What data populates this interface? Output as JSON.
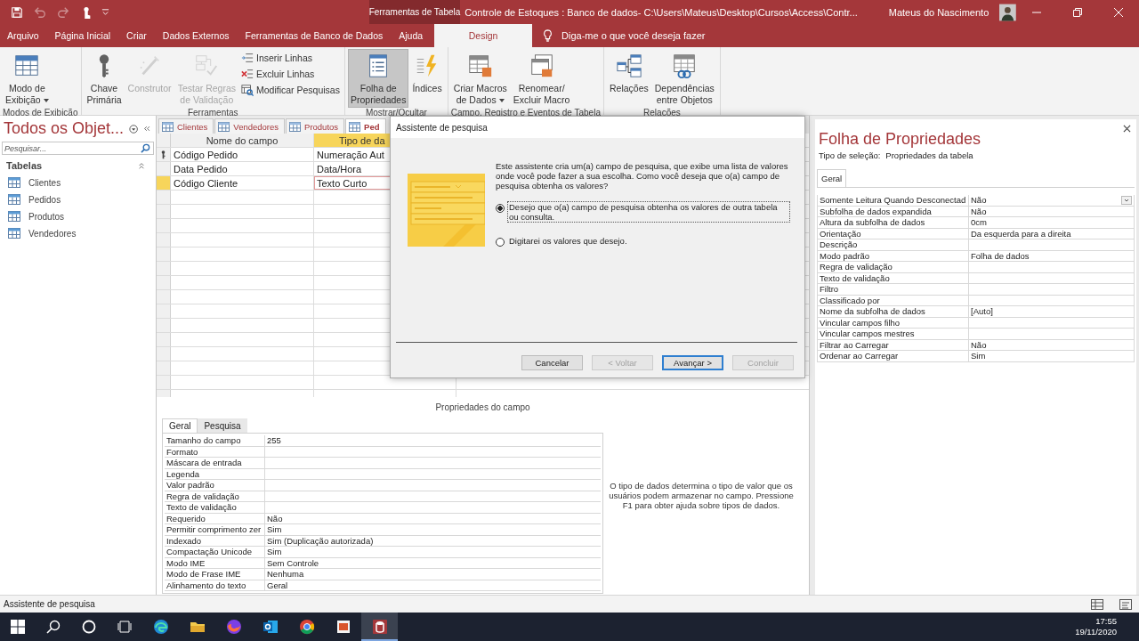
{
  "title_bar": {
    "quick_access": [
      {
        "disabled": false
      },
      {
        "disabled": true
      },
      {
        "disabled": true
      },
      {
        "disabled": false
      }
    ],
    "context_tab": "Ferramentas de Tabela",
    "title": "Controle de Estoques : Banco de dados- C:\\Users\\Mateus\\Desktop\\Cursos\\Access\\Contr...",
    "user": "Mateus do Nascimento"
  },
  "ribbon_tabs": [
    {
      "label": "Arquivo",
      "selected": false
    },
    {
      "label": "Página Inicial",
      "selected": false
    },
    {
      "label": "Criar",
      "selected": false
    },
    {
      "label": "Dados Externos",
      "selected": false
    },
    {
      "label": "Ferramentas de Banco de Dados",
      "selected": false
    },
    {
      "label": "Ajuda",
      "selected": false
    },
    {
      "label": "Design",
      "selected": true
    }
  ],
  "tell_me": "Diga-me o que você deseja fazer",
  "ribbon_groups": [
    {
      "label": "Modos de Exibição",
      "buttons": [
        {
          "label": "Modo de\nExibição",
          "kind": "large",
          "menu": true,
          "disabled": false,
          "selected": false
        }
      ]
    },
    {
      "label": "Ferramentas",
      "buttons": [
        {
          "label": "Chave\nPrimária",
          "kind": "large",
          "menu": false,
          "disabled": false,
          "selected": false
        },
        {
          "label": "Construtor",
          "kind": "large",
          "menu": false,
          "disabled": true,
          "selected": false
        },
        {
          "label": "Testar Regras\nde Validação",
          "kind": "large",
          "menu": false,
          "disabled": true,
          "selected": false
        },
        {
          "label": "Inserir Linhas",
          "kind": "small",
          "disabled": false
        },
        {
          "label": "Excluir Linhas",
          "kind": "small",
          "disabled": false
        },
        {
          "label": "Modificar Pesquisas",
          "kind": "small",
          "disabled": false
        }
      ]
    },
    {
      "label": "Mostrar/Ocultar",
      "buttons": [
        {
          "label": "Folha de\nPropriedades",
          "kind": "large",
          "menu": false,
          "disabled": false,
          "selected": true
        },
        {
          "label": "Índices",
          "kind": "large",
          "menu": false,
          "disabled": false,
          "selected": false
        }
      ]
    },
    {
      "label": "Campo, Registro e Eventos de Tabela",
      "buttons": [
        {
          "label": "Criar Macros\nde Dados",
          "kind": "large",
          "menu": true,
          "disabled": false,
          "selected": false
        },
        {
          "label": "Renomear/\nExcluir Macro",
          "kind": "large",
          "menu": false,
          "disabled": false,
          "selected": false
        }
      ]
    },
    {
      "label": "Relações",
      "buttons": [
        {
          "label": "Relações",
          "kind": "large",
          "menu": false,
          "disabled": false,
          "selected": false
        },
        {
          "label": "Dependências\nentre Objetos",
          "kind": "large",
          "menu": false,
          "disabled": false,
          "selected": false
        }
      ]
    }
  ],
  "navigation": {
    "title": "Todos os Objet...",
    "search_placeholder": "Pesquisar...",
    "groups": [
      {
        "label": "Tabelas",
        "expanded": true,
        "items": [
          "Clientes",
          "Pedidos",
          "Produtos",
          "Vendedores"
        ]
      }
    ]
  },
  "document_tabs": [
    {
      "label": "Clientes",
      "selected": false
    },
    {
      "label": "Vendedores",
      "selected": false
    },
    {
      "label": "Produtos",
      "selected": false
    },
    {
      "label": "Ped",
      "selected": true
    }
  ],
  "design_grid": {
    "columns": [
      {
        "label": "Nome do campo",
        "selected": false
      },
      {
        "label": "Tipo de da",
        "selected": true
      }
    ],
    "rows": [
      {
        "name": "Código Pedido",
        "type": "Numeração Aut",
        "primary_key": true,
        "selected": false
      },
      {
        "name": "Data Pedido",
        "type": "Data/Hora",
        "primary_key": false,
        "selected": false
      },
      {
        "name": "Código Cliente",
        "type": "Texto Curto",
        "primary_key": false,
        "selected": true
      }
    ]
  },
  "field_properties": {
    "heading": "Propriedades do campo",
    "tabs": [
      {
        "label": "Geral",
        "selected": true
      },
      {
        "label": "Pesquisa",
        "selected": false
      }
    ],
    "rows": [
      {
        "label": "Tamanho do campo",
        "value": "255"
      },
      {
        "label": "Formato"
      },
      {
        "label": "Máscara de entrada"
      },
      {
        "label": "Legenda"
      },
      {
        "label": "Valor padrão"
      },
      {
        "label": "Regra de validação"
      },
      {
        "label": "Texto de validação"
      },
      {
        "label": "Requerido",
        "value": "Não"
      },
      {
        "label": "Permitir comprimento zer",
        "value": "Sim"
      },
      {
        "label": "Indexado",
        "value": "Sim (Duplicação autorizada)"
      },
      {
        "label": "Compactação Unicode",
        "value": "Sim"
      },
      {
        "label": "Modo IME",
        "value": "Sem Controle"
      },
      {
        "label": "Modo de Frase IME",
        "value": "Nenhuma"
      },
      {
        "label": "Alinhamento do texto",
        "value": "Geral"
      }
    ],
    "help": "O tipo de dados determina o tipo de valor que os usuários podem armazenar no campo. Pressione F1 para obter ajuda sobre tipos de dados."
  },
  "property_sheet": {
    "title": "Folha de Propriedades",
    "selection_label": "Tipo de seleção:",
    "selection": "Propriedades da tabela",
    "tabs": [
      {
        "label": "Geral",
        "selected": true
      }
    ],
    "rows": [
      {
        "label": "Somente Leitura Quando Desconectad",
        "value": "Não",
        "selected": true
      },
      {
        "label": "Subfolha de dados expandida",
        "value": "Não",
        "selected": false
      },
      {
        "label": "Altura da subfolha de dados",
        "value": "0cm",
        "selected": false
      },
      {
        "label": "Orientação",
        "value": "Da esquerda para a direita",
        "selected": false
      },
      {
        "label": "Descrição",
        "selected": false
      },
      {
        "label": "Modo padrão",
        "value": "Folha de dados",
        "selected": false
      },
      {
        "label": "Regra de validação",
        "selected": false
      },
      {
        "label": "Texto de validação",
        "selected": false
      },
      {
        "label": "Filtro",
        "selected": false
      },
      {
        "label": "Classificado por",
        "selected": false
      },
      {
        "label": "Nome da subfolha de dados",
        "value": "[Auto]",
        "selected": false
      },
      {
        "label": "Vincular campos filho",
        "selected": false
      },
      {
        "label": "Vincular campos mestres",
        "selected": false
      },
      {
        "label": "Filtrar ao Carregar",
        "value": "Não",
        "selected": false
      },
      {
        "label": "Ordenar ao Carregar",
        "value": "Sim",
        "selected": false
      }
    ]
  },
  "dialog": {
    "title": "Assistente de pesquisa",
    "intro": "Este assistente cria um(a) campo de pesquisa, que exibe uma lista de valores onde você pode fazer a sua escolha.  Como você deseja que o(a) campo de pesquisa obtenha os valores?",
    "options": [
      {
        "label": "Desejo que o(a) campo de pesquisa obtenha os valores de outra tabela ou consulta.",
        "selected": true
      },
      {
        "label": "Digitarei os valores que desejo.",
        "selected": false
      }
    ],
    "buttons": [
      {
        "label": "Cancelar",
        "disabled": false,
        "default": false
      },
      {
        "label": "< Voltar",
        "disabled": true,
        "default": false
      },
      {
        "label": "Avançar >",
        "disabled": false,
        "default": true
      },
      {
        "label": "Concluir",
        "disabled": true,
        "default": false
      }
    ]
  },
  "status_bar": {
    "text": "Assistente de pesquisa"
  },
  "taskbar": {
    "apps": [
      {
        "active": false
      },
      {
        "active": false
      },
      {
        "active": false
      },
      {
        "active": false
      },
      {
        "active": false
      },
      {
        "active": false
      },
      {
        "active": true
      }
    ],
    "time": "17:55",
    "date": "19/11/2020"
  }
}
